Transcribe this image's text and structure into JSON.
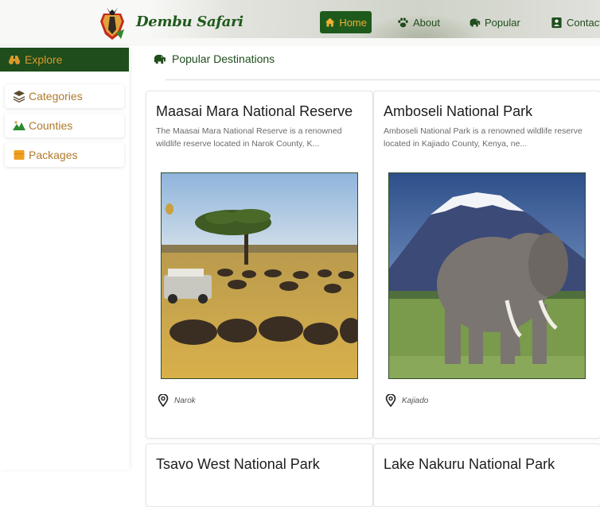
{
  "brand": {
    "name": "Dembu Safari"
  },
  "nav": [
    {
      "label": "Home",
      "icon": "home-icon",
      "active": true
    },
    {
      "label": "About",
      "icon": "paw-icon"
    },
    {
      "label": "Popular",
      "icon": "elephant-icon"
    },
    {
      "label": "Contact",
      "icon": "contact-icon"
    }
  ],
  "sidebar": {
    "header": {
      "label": "Explore",
      "icon": "binoculars-icon"
    },
    "items": [
      {
        "label": "Categories",
        "icon": "layers-icon"
      },
      {
        "label": "Counties",
        "icon": "mountain-icon"
      },
      {
        "label": "Packages",
        "icon": "package-icon"
      }
    ]
  },
  "main": {
    "section_title": "Popular Destinations",
    "cards": [
      {
        "title": "Maasai Mara National Reserve",
        "description": "The Maasai Mara National Reserve is a renowned wildlife reserve located in Narok County, K...",
        "location": "Narok"
      },
      {
        "title": "Amboseli National Park",
        "description": "Amboseli National Park is a renowned wildlife reserve located in Kajiado County, Kenya, ne...",
        "location": "Kajiado"
      },
      {
        "title": "Tsavo West National Park"
      },
      {
        "title": "Lake Nakuru National Park"
      }
    ]
  },
  "colors": {
    "brand_green": "#1f4d1c",
    "accent_gold": "#d99a2a",
    "link_gold": "#b07a2c"
  }
}
